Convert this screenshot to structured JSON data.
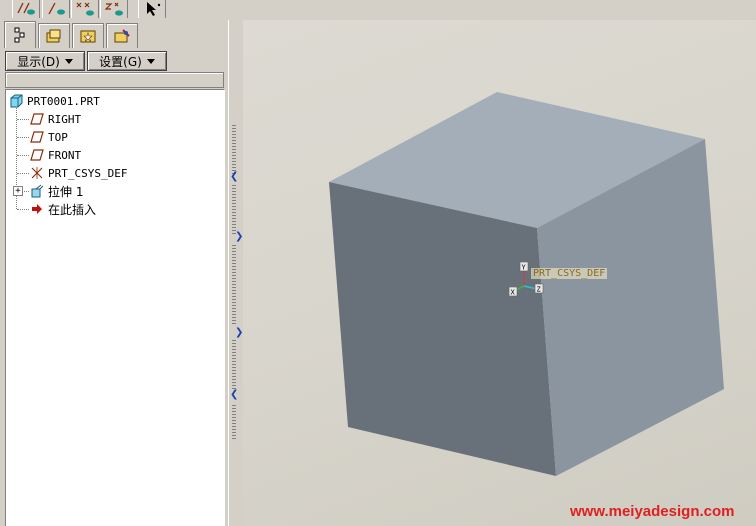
{
  "toolbar": {
    "icons": [
      "plane-display-icon",
      "axis-display-icon",
      "point-display-icon",
      "csys-display-icon",
      "select-arrow-icon"
    ]
  },
  "panel": {
    "tabs": [
      "model-tree-tab",
      "folder-browser-tab",
      "favorites-tab",
      "web-connections-tab"
    ],
    "display_label": "显示(D)",
    "settings_label": "设置(G)"
  },
  "tree": {
    "root": "PRT0001.PRT",
    "items": [
      {
        "label": "RIGHT",
        "icon": "datum-plane-icon"
      },
      {
        "label": "TOP",
        "icon": "datum-plane-icon"
      },
      {
        "label": "FRONT",
        "icon": "datum-plane-icon"
      },
      {
        "label": "PRT_CSYS_DEF",
        "icon": "coordinate-system-icon"
      },
      {
        "label": "拉伸 1",
        "icon": "extrude-icon"
      },
      {
        "label": "在此插入",
        "icon": "insert-here-arrow-icon"
      }
    ]
  },
  "viewport": {
    "csys_label": "PRT_CSYS_DEF",
    "watermark": "www.meiyadesign.com",
    "colors": {
      "background": "#d8d5cc",
      "top_face": "#a3aeb8",
      "left_face": "#68717a",
      "right_face": "#8a959f"
    }
  }
}
